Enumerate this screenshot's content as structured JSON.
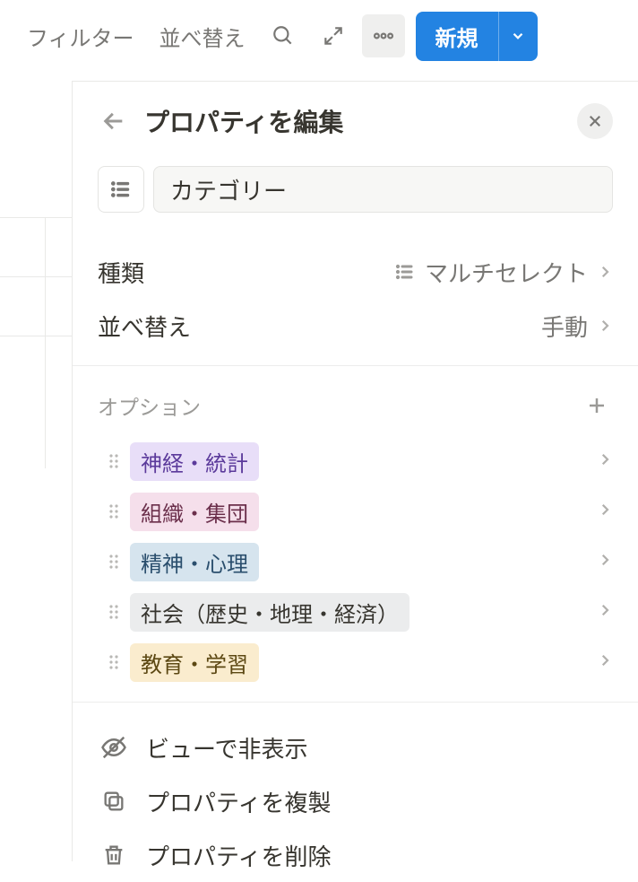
{
  "toolbar": {
    "filter": "フィルター",
    "sort": "並べ替え",
    "new": "新規"
  },
  "panel": {
    "title": "プロパティを編集",
    "name": "カテゴリー",
    "type_label": "種類",
    "type_value": "マルチセレクト",
    "sort_label": "並べ替え",
    "sort_value": "手動",
    "options_label": "オプション",
    "options": [
      {
        "label": "神経・統計"
      },
      {
        "label": "組織・集団"
      },
      {
        "label": "精神・心理"
      },
      {
        "label": "社会（歴史・地理・経済）"
      },
      {
        "label": "教育・学習"
      }
    ],
    "actions": {
      "hide": "ビューで非表示",
      "duplicate": "プロパティを複製",
      "delete": "プロパティを削除"
    }
  }
}
